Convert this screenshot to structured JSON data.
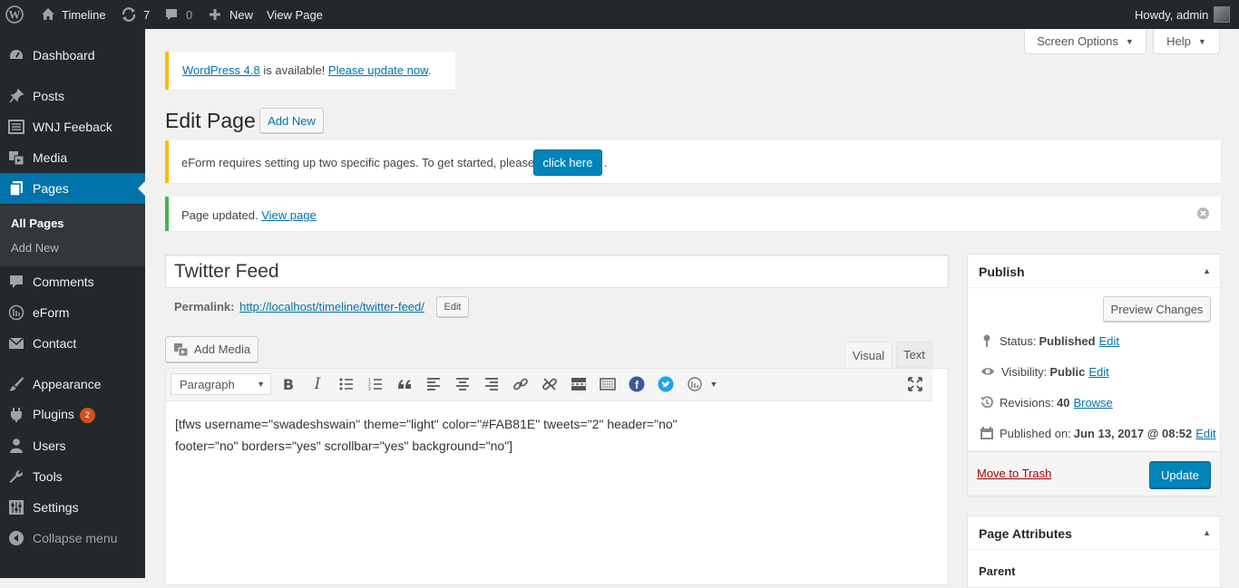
{
  "adminbar": {
    "site": "Timeline",
    "updates": "7",
    "comments": "0",
    "new": "New",
    "view": "View Page",
    "howdy": "Howdy, admin"
  },
  "menu": {
    "dashboard": "Dashboard",
    "posts": "Posts",
    "wnj": "WNJ Feeback",
    "media": "Media",
    "pages": "Pages",
    "all_pages": "All Pages",
    "add_new": "Add New",
    "comments": "Comments",
    "eform": "eForm",
    "contact": "Contact",
    "appearance": "Appearance",
    "plugins": "Plugins",
    "plugins_badge": "2",
    "users": "Users",
    "tools": "Tools",
    "settings": "Settings",
    "collapse": "Collapse menu"
  },
  "screen_options": "Screen Options",
  "help": "Help",
  "update_notice": {
    "link1": "WordPress 4.8",
    "mid": " is available! ",
    "link2": "Please update now",
    "end": "."
  },
  "heading": {
    "title": "Edit Page",
    "add_new": "Add New"
  },
  "eform_notice": {
    "text": "eForm requires setting up two specific pages. To get started, please",
    "button": "click here",
    "end": "."
  },
  "updated_notice": {
    "text": "Page updated. ",
    "link": "View page"
  },
  "post_title": "Twitter Feed",
  "permalink": {
    "label": "Permalink:",
    "url": "http://localhost/timeline/twitter-feed/",
    "edit": "Edit"
  },
  "editor": {
    "add_media": "Add Media",
    "tab_visual": "Visual",
    "tab_text": "Text",
    "format": "Paragraph",
    "line1": "[tfws username=\"swadeshswain\" theme=\"light\" color=\"#FAB81E\" tweets=\"2\" header=\"no\"",
    "line2": "footer=\"no\" borders=\"yes\" scrollbar=\"yes\" background=\"no\"]"
  },
  "publish": {
    "title": "Publish",
    "preview": "Preview Changes",
    "status_label": "Status: ",
    "status_value": "Published",
    "visibility_label": "Visibility: ",
    "visibility_value": "Public",
    "revisions_label": "Revisions: ",
    "revisions_value": "40",
    "browse": "Browse",
    "published_label": "Published on: ",
    "published_value": "Jun 13, 2017 @ 08:52",
    "edit": "Edit",
    "trash": "Move to Trash",
    "update": "Update"
  },
  "page_attributes": {
    "title": "Page Attributes",
    "parent": "Parent"
  },
  "colors": {
    "accent": "#0073aa",
    "admin_bg": "#23282d",
    "warn": "#ffb900",
    "success": "#46b450"
  }
}
